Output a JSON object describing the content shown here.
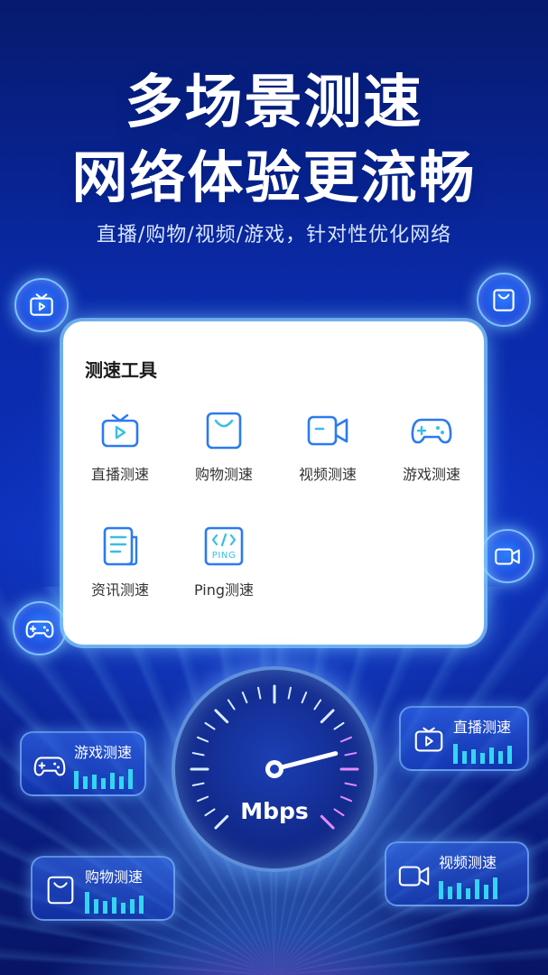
{
  "hero": {
    "title_line1": "多场景测速",
    "title_line2": "网络体验更流畅",
    "subtitle": "直播/购物/视频/游戏，针对性优化网络"
  },
  "floating_icons": [
    "tv-icon",
    "shopping-bag-icon",
    "video-camera-icon",
    "gamepad-icon"
  ],
  "tool_panel": {
    "title": "测速工具",
    "items": [
      {
        "label": "直播测速",
        "icon": "tv-icon"
      },
      {
        "label": "购物测速",
        "icon": "shopping-bag-icon"
      },
      {
        "label": "视频测速",
        "icon": "video-camera-icon"
      },
      {
        "label": "游戏测速",
        "icon": "gamepad-icon"
      },
      {
        "label": "资讯测速",
        "icon": "news-document-icon"
      },
      {
        "label": "Ping测速",
        "icon": "ping-icon"
      }
    ]
  },
  "gauge": {
    "unit": "Mbps",
    "needle_fraction": 0.78
  },
  "side_cards": {
    "game": {
      "label": "游戏测速",
      "icon": "gamepad-icon"
    },
    "live": {
      "label": "直播测速",
      "icon": "tv-icon"
    },
    "shopping": {
      "label": "购物测速",
      "icon": "shopping-bag-icon"
    },
    "video": {
      "label": "视频测速",
      "icon": "video-camera-icon"
    }
  },
  "colors": {
    "accent": "#2a7bf0",
    "accent_light": "#35c0e6",
    "background": "#0a2aa8"
  }
}
